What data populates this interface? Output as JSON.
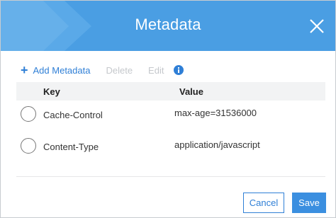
{
  "dialog": {
    "title": "Metadata"
  },
  "toolbar": {
    "add_label": "Add Metadata",
    "delete_label": "Delete",
    "edit_label": "Edit"
  },
  "table": {
    "columns": [
      "Key",
      "Value"
    ],
    "rows": [
      {
        "key": "Cache-Control",
        "value": "max-age=31536000"
      },
      {
        "key": "Content-Type",
        "value": "application/javascript"
      }
    ]
  },
  "footer": {
    "cancel_label": "Cancel",
    "save_label": "Save"
  },
  "colors": {
    "header_bg": "#4a9ee3",
    "accent": "#2f7fd6",
    "disabled": "#c5c8cc"
  },
  "icons": {
    "add": "plus-icon",
    "info": "info-icon",
    "close": "close-icon"
  }
}
